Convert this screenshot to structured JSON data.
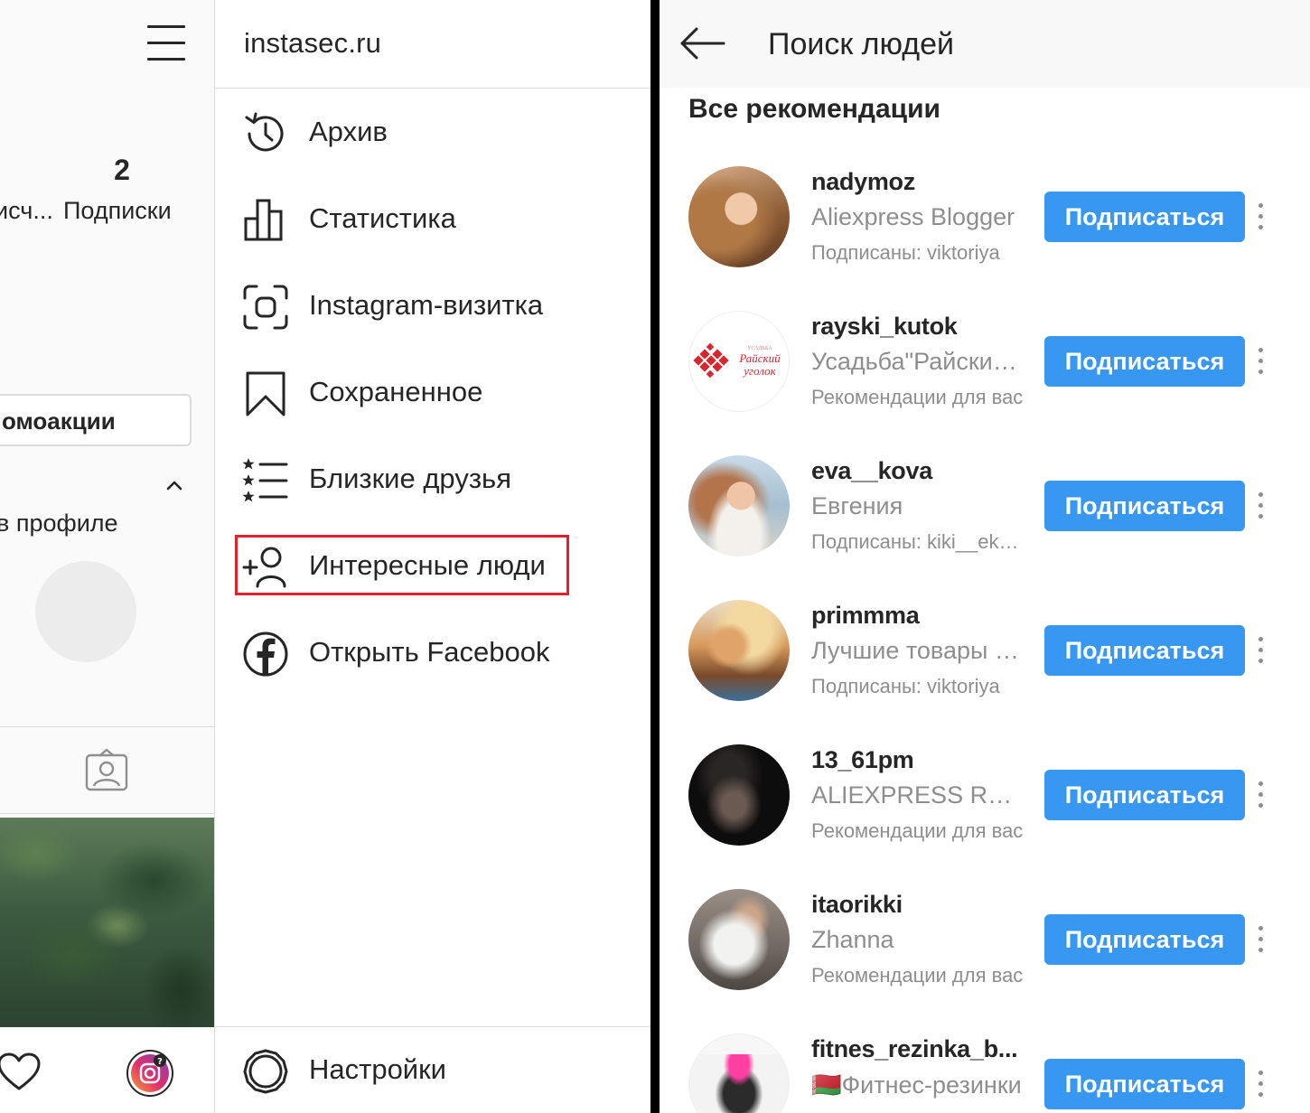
{
  "profile_peek": {
    "followers_label_partial": "исч...",
    "following_count": "2",
    "following_label": "Подписки",
    "promo_button_label": "омоакции",
    "in_profile_text": "в профиле"
  },
  "drawer": {
    "title": "instasec.ru",
    "items": [
      {
        "label": "Архив",
        "icon": "archive-clock-icon"
      },
      {
        "label": "Статистика",
        "icon": "bar-chart-icon"
      },
      {
        "label": "Instagram-визитка",
        "icon": "nametag-scan-icon"
      },
      {
        "label": "Сохраненное",
        "icon": "bookmark-icon"
      },
      {
        "label": "Близкие друзья",
        "icon": "close-friends-list-icon"
      },
      {
        "label": "Интересные люди",
        "icon": "add-person-icon",
        "highlighted": true
      },
      {
        "label": "Открыть Facebook",
        "icon": "facebook-icon"
      }
    ],
    "settings_label": "Настройки"
  },
  "discover": {
    "title": "Поиск людей",
    "section_title": "Все рекомендации",
    "follow_label": "Подписаться",
    "people": [
      {
        "username": "nadymoz",
        "name": "Aliexpress Blogger",
        "reason": "Подписаны: viktoriya"
      },
      {
        "username": "rayski_kutok",
        "name": "Усадьба\"Райский уголок\"",
        "reason": "Рекомендации для вас"
      },
      {
        "username": "eva__kova",
        "name": "Евгения",
        "reason": "Подписаны: kiki__ekaterina"
      },
      {
        "username": "primmma",
        "name": "Лучшие товары с Aliexpress",
        "reason": "Подписаны: viktoriya"
      },
      {
        "username": "13_61pm",
        "name": "ALIEXPRESS REVIEW",
        "reason": "Рекомендации для вас"
      },
      {
        "username": "itaorikki",
        "name": "Zhanna",
        "reason": "Рекомендации для вас"
      },
      {
        "username": "fitnes_rezinka_b...",
        "name": "🇧🇾Фитнес-резинки",
        "reason": ""
      }
    ]
  },
  "colors": {
    "accent_blue": "#3897f0",
    "highlight_red": "#e0202c",
    "text_primary": "#262626",
    "text_secondary": "#8e8e8e"
  }
}
